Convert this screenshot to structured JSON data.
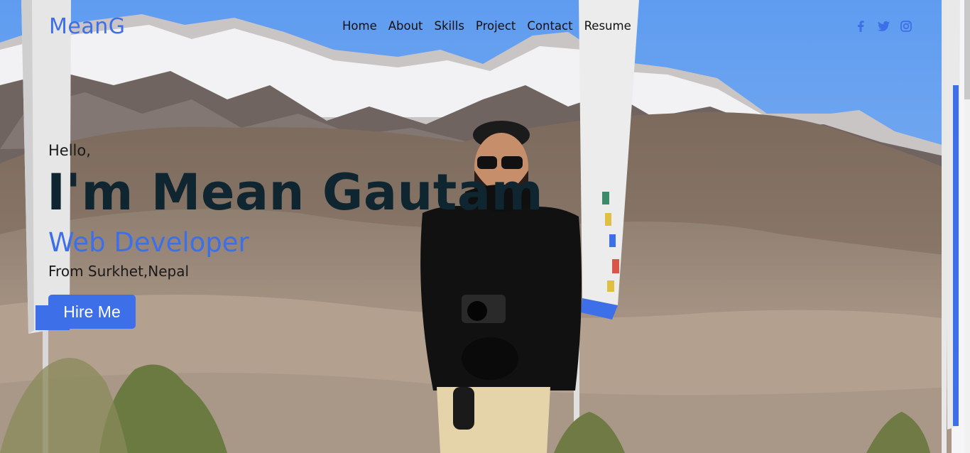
{
  "brand": "MeanG",
  "nav": {
    "items": [
      "Home",
      "About",
      "Skills",
      "Project",
      "Contact",
      "Resume"
    ]
  },
  "socials": [
    {
      "icon": "facebook-icon"
    },
    {
      "icon": "twitter-icon"
    },
    {
      "icon": "instagram-icon"
    }
  ],
  "hero": {
    "greeting": "Hello,",
    "name": "I'm Mean Gautam",
    "role": "Web Developer",
    "location": "From Surkhet,Nepal",
    "cta": "Hire Me"
  },
  "colors": {
    "accent": "#3d6fe8",
    "heading": "#0f2530",
    "sky": "#6fa6f0"
  }
}
